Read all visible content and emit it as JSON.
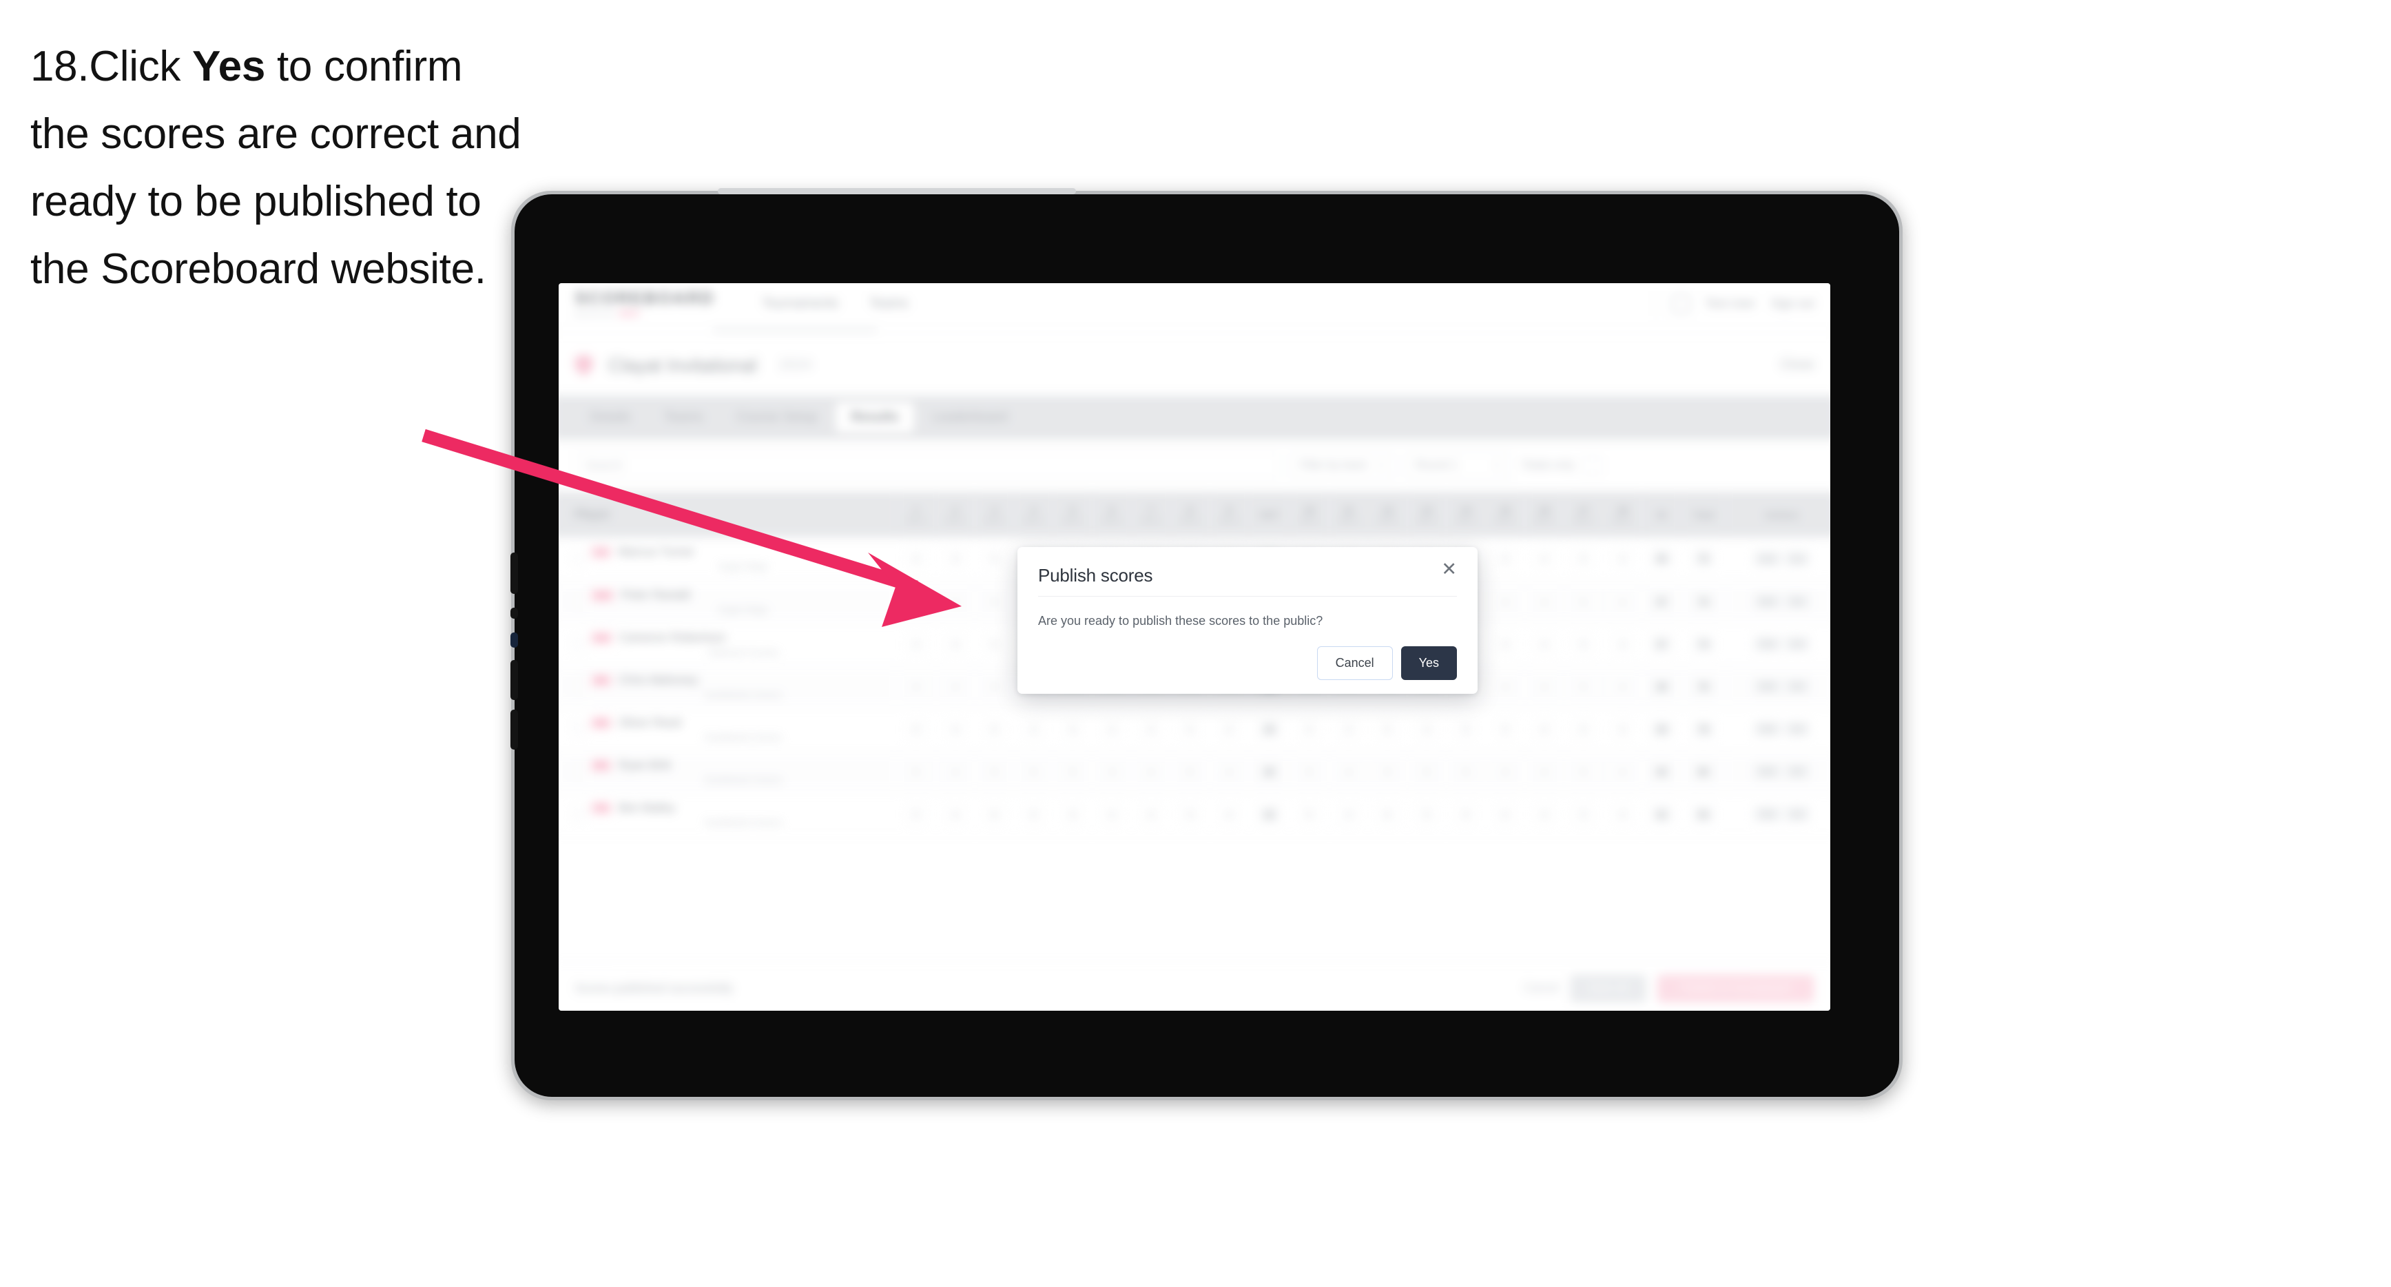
{
  "caption": {
    "step_number": "18.",
    "text_before": "Click ",
    "bold_word": "Yes",
    "text_after": " to confirm the scores are correct and ready to be published to the Scoreboard website."
  },
  "annotation": {
    "arrow_color": "#ed2a62",
    "arrow_points_to": "yes-button"
  },
  "device": {
    "type": "tablet",
    "frame_color": "#b9bbbd",
    "bezel_color": "#0b0b0b"
  },
  "app": {
    "header": {
      "logo": "SCOREBOARD",
      "logo_sub": "powered by",
      "logo_sub_tag": "GOLF",
      "nav": [
        "Tournaments",
        "Teams"
      ],
      "avatar_icon": "user-avatar-icon",
      "user_name": "Test User",
      "signout_label": "Sign out"
    },
    "page_title": {
      "icon": "shield-icon",
      "title": "Clayat Invitational",
      "subtitle": "2024",
      "right_link": "Close"
    },
    "tabs": [
      {
        "label": "Details",
        "active": false
      },
      {
        "label": "Teams",
        "active": false
      },
      {
        "label": "Course Setup",
        "active": false
      },
      {
        "label": "Results",
        "active": true
      },
      {
        "label": "Leaderboard",
        "active": false
      }
    ],
    "filters": {
      "search_placeholder": "Search",
      "select_one": "Filter by team",
      "select_two": "Round 1",
      "right_label": "Totals only",
      "right_icon": "settings-icon"
    },
    "table": {
      "player_header": "Player",
      "hole_headers": [
        {
          "num": "1",
          "par": "Par 4"
        },
        {
          "num": "2",
          "par": "Par 3"
        },
        {
          "num": "3",
          "par": "Par 5"
        },
        {
          "num": "4",
          "par": "Par 4"
        },
        {
          "num": "5",
          "par": "Par 4"
        },
        {
          "num": "6",
          "par": "Par 3"
        },
        {
          "num": "7",
          "par": "Par 4"
        },
        {
          "num": "8",
          "par": "Par 5"
        },
        {
          "num": "9",
          "par": "Par 4"
        }
      ],
      "out_header": "OUT",
      "hole_headers_back": [
        {
          "num": "10",
          "par": "Par 4"
        },
        {
          "num": "11",
          "par": "Par 3"
        },
        {
          "num": "12",
          "par": "Par 5"
        },
        {
          "num": "13",
          "par": "Par 4"
        },
        {
          "num": "14",
          "par": "Par 4"
        },
        {
          "num": "15",
          "par": "Par 3"
        },
        {
          "num": "16",
          "par": "Par 4"
        },
        {
          "num": "17",
          "par": "Par 5"
        },
        {
          "num": "18",
          "par": "Par 4"
        }
      ],
      "in_header": "IN",
      "total_header": "Total",
      "actions_header": "Actions",
      "rows": [
        {
          "pos": "1st",
          "name": "Marcus Turner",
          "club": "Eagle Ridge",
          "front": [
            "4",
            "3",
            "5",
            "4",
            "4",
            "3",
            "4",
            "5",
            "4"
          ],
          "out": "36",
          "back": [
            "4",
            "3",
            "5",
            "4",
            "4",
            "3",
            "4",
            "5",
            "4"
          ],
          "in": "36",
          "total": "72",
          "net": "70",
          "actions": [
            "Edit",
            "Del"
          ]
        },
        {
          "pos": "2nd",
          "name": "Peter Ranald",
          "club": "Eagle Ridge",
          "front": [
            "4",
            "3",
            "5",
            "4",
            "4",
            "3",
            "4",
            "5",
            "4"
          ],
          "out": "36",
          "back": [
            "4",
            "3",
            "5",
            "4",
            "4",
            "3",
            "4",
            "5",
            "4"
          ],
          "in": "37",
          "total": "73",
          "net": "71",
          "actions": [
            "Edit",
            "Del"
          ]
        },
        {
          "pos": "3rd",
          "name": "Cameron Robertson",
          "club": "Oakmont Country",
          "front": [
            "4",
            "3",
            "5",
            "4",
            "4",
            "3",
            "4",
            "5",
            "4"
          ],
          "out": "37",
          "back": [
            "4",
            "3",
            "5",
            "4",
            "4",
            "3",
            "4",
            "5",
            "4"
          ],
          "in": "37",
          "total": "74",
          "net": "72",
          "actions": [
            "Edit",
            "Del"
          ]
        },
        {
          "pos": "4th",
          "name": "Chris Mahoney",
          "club": "Southlands Greens",
          "front": [
            "4",
            "4",
            "5",
            "4",
            "5",
            "3",
            "4",
            "5",
            "4"
          ],
          "out": "38",
          "back": [
            "4",
            "4",
            "5",
            "4",
            "5",
            "3",
            "4",
            "5",
            "4"
          ],
          "in": "38",
          "total": "76",
          "net": "73",
          "actions": [
            "Edit",
            "Del"
          ]
        },
        {
          "pos": "5th",
          "name": "Oliver Reed",
          "club": "Southlands Greens",
          "front": [
            "5",
            "4",
            "5",
            "4",
            "5",
            "3",
            "4",
            "5",
            "4"
          ],
          "out": "39",
          "back": [
            "5",
            "4",
            "5",
            "4",
            "5",
            "3",
            "4",
            "5",
            "4"
          ],
          "in": "39",
          "total": "78",
          "net": "74",
          "actions": [
            "Edit",
            "Del"
          ]
        },
        {
          "pos": "6th",
          "name": "Ryan Britt",
          "club": "Southlands Greens",
          "front": [
            "5",
            "4",
            "5",
            "5",
            "5",
            "3",
            "4",
            "5",
            "4"
          ],
          "out": "40",
          "back": [
            "5",
            "4",
            "5",
            "5",
            "5",
            "3",
            "4",
            "5",
            "4"
          ],
          "in": "40",
          "total": "80",
          "net": "76",
          "actions": [
            "Edit",
            "Del"
          ]
        },
        {
          "pos": "7th",
          "name": "Ben Bailey",
          "club": "Southlands Greens",
          "front": [
            "5",
            "4",
            "6",
            "5",
            "5",
            "4",
            "4",
            "5",
            "4"
          ],
          "out": "42",
          "back": [
            "5",
            "4",
            "6",
            "5",
            "5",
            "4",
            "4",
            "5",
            "4"
          ],
          "in": "42",
          "total": "84",
          "net": "79",
          "actions": [
            "Edit",
            "Del"
          ]
        }
      ]
    },
    "bottom_bar": {
      "status": "Scores published successfully",
      "link": "Cancel",
      "secondary_button": "Save all",
      "primary_button": "Publish to Scoreboard"
    }
  },
  "modal": {
    "title": "Publish scores",
    "close_icon": "close-icon",
    "body": "Are you ready to publish these scores to the public?",
    "cancel_label": "Cancel",
    "confirm_label": "Yes",
    "confirm_bg": "#2c3648",
    "cancel_border": "#c9d9f2"
  }
}
